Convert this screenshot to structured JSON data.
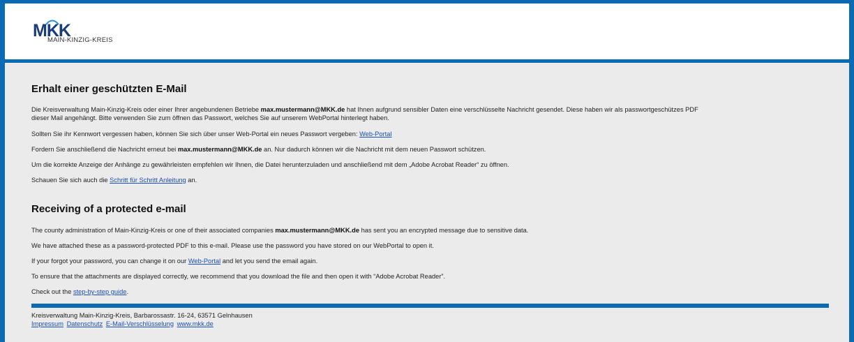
{
  "colors": {
    "brand_blue": "#0a6ab3",
    "background": "#ebebeb",
    "link": "#1a4fb4"
  },
  "logo": {
    "mark": "MKK",
    "subtitle": "MAIN-KINZIG-KREIS"
  },
  "german": {
    "heading": "Erhalt einer geschützten E-Mail",
    "p1_a": "Die Kreisverwaltung Main-Kinzig-Kreis oder einer Ihrer angebundenen Betriebe ",
    "p1_email": "max.mustermann@MKK.de",
    "p1_b": " hat Ihnen aufgrund sensibler Daten eine verschlüsselte Nachricht gesendet. Diese haben wir als passwortgeschützes PDF",
    "p1_line2": "dieser Mail angehängt. Bitte verwenden Sie zum öffnen das Passwort, welches Sie auf unserem WebPortal hinterlegt haben.",
    "p2_a": "Sollten Sie ihr Kennwort vergessen haben, können Sie sich über unser Web-Portal ein neues Passwort vergeben: ",
    "p2_link": "Web-Portal",
    "p3_a": "Fordern Sie anschließend die Nachricht erneut bei ",
    "p3_email": "max.mustermann@MKK.de",
    "p3_b": " an. Nur dadurch können wir die Nachricht mit dem neuen Passwort schützen.",
    "p4": "Um die korrekte Anzeige der Anhänge zu gewährleisten empfehlen wir Ihnen, die Datei herunterzuladen und anschließend mit dem „Adobe Acrobat Reader“ zu öffnen.",
    "p5_a": "Schauen Sie sich auch die ",
    "p5_link": "Schritt für Schritt Anleitung",
    "p5_b": " an."
  },
  "english": {
    "heading": "Receiving of a protected e-mail",
    "p1_a": "The county administration of Main-Kinzig-Kreis or one of their associated companies ",
    "p1_email": "max.mustermann@MKK.de",
    "p1_b": " has sent you an encrypted message due to sensitive data.",
    "p2": "We have attached these as a password-protected PDF to this e-mail. Please use the password you have stored on our WebPortal to open it.",
    "p3_a": "If your forgot your password, you can change it on our ",
    "p3_link": "Web-Portal",
    "p3_b": " and let you send the email again.",
    "p4": "To ensure that the attachments are displayed correctly, we recommend that you download the file and then open it with “Adobe Acrobat Reader”.",
    "p5_a": "Check out the ",
    "p5_link": "step-by-step guide",
    "p5_b": "."
  },
  "footer": {
    "address": "Kreisverwaltung Main-Kinzig-Kreis, Barbarossastr. 16-24, 63571 Gelnhausen",
    "links": [
      "Impressum",
      "Datenschutz",
      "E-Mail-Verschlüsselung",
      "www.mkk.de"
    ]
  }
}
